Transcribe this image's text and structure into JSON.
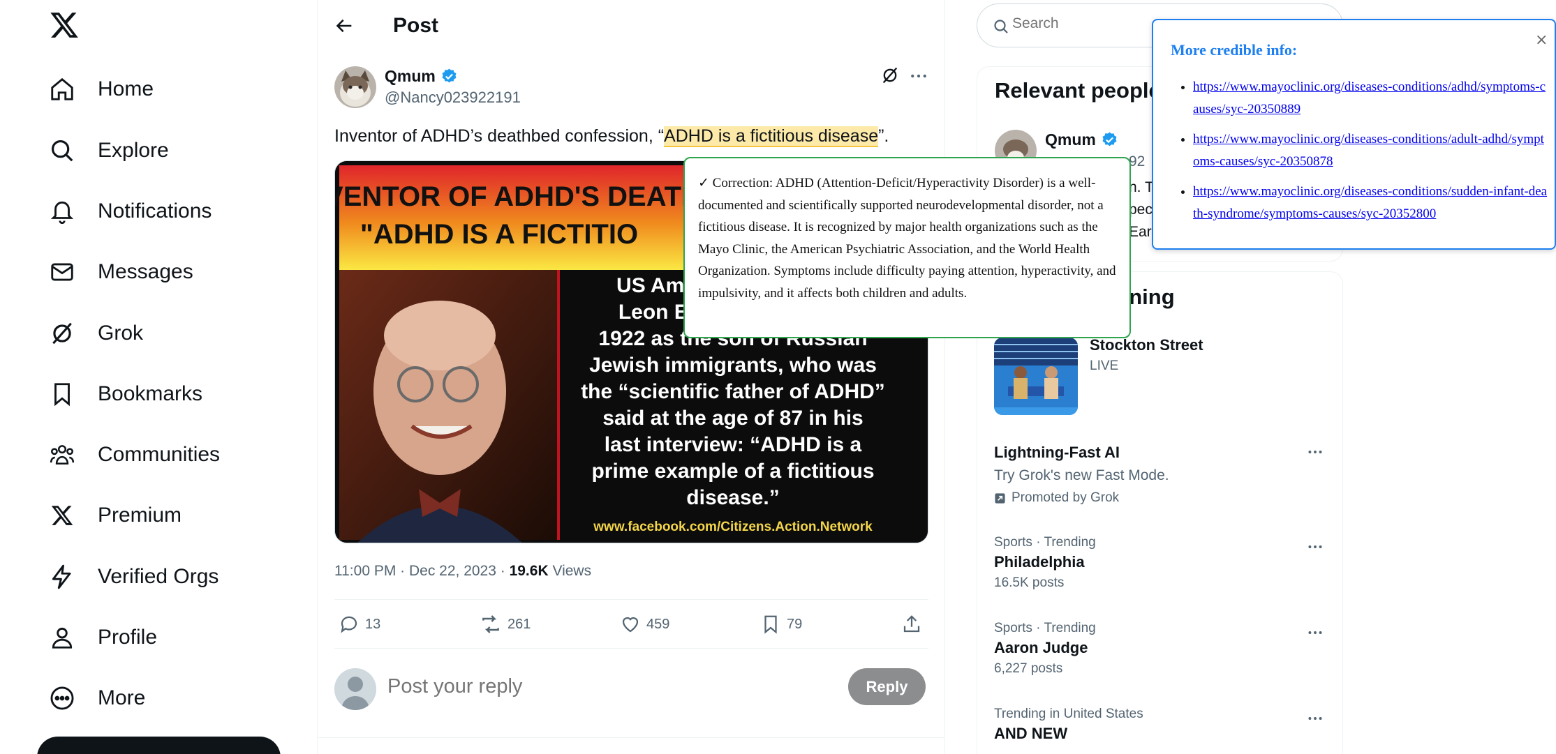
{
  "nav": {
    "items": [
      {
        "label": "Home",
        "icon": "home-icon"
      },
      {
        "label": "Explore",
        "icon": "search-icon"
      },
      {
        "label": "Notifications",
        "icon": "bell-icon"
      },
      {
        "label": "Messages",
        "icon": "envelope-icon"
      },
      {
        "label": "Grok",
        "icon": "grok-icon"
      },
      {
        "label": "Bookmarks",
        "icon": "bookmark-icon"
      },
      {
        "label": "Communities",
        "icon": "communities-icon"
      },
      {
        "label": "Premium",
        "icon": "x-logo-icon"
      },
      {
        "label": "Verified Orgs",
        "icon": "lightning-icon"
      },
      {
        "label": "Profile",
        "icon": "person-icon"
      },
      {
        "label": "More",
        "icon": "more-circle-icon"
      }
    ]
  },
  "header": {
    "title": "Post"
  },
  "post": {
    "author_name": "Qmum",
    "author_handle": "@Nancy023922191",
    "text_before": "Inventor of ADHD’s deathbed confession, “",
    "text_highlight": "ADHD is a fictitious disease",
    "text_after": "”.",
    "image": {
      "headline_1": "INVENTOR OF ADHD'S DEATH",
      "headline_2": "\"ADHD IS A FICTITIO",
      "body_lines": [
        "US Ame",
        "Leon Ei",
        "1922 as the son of Russian",
        "Jewish immigrants, who was",
        "the “scientific father of ADHD”",
        "said at the age of 87 in his",
        "last interview: “ADHD is a",
        "prime example of a fictitious",
        "disease.”"
      ],
      "source": "www.facebook.com/Citizens.Action.Network"
    },
    "time": "11:00 PM · Dec 22, 2023 · ",
    "views_count": "19.6K",
    "views_label": " Views",
    "stats": {
      "replies": "13",
      "reposts": "261",
      "likes": "459",
      "bookmarks": "79"
    }
  },
  "reply": {
    "placeholder": "Post your reply",
    "button_label": "Reply"
  },
  "sidebar": {
    "search_placeholder": "Search",
    "relevant_title": "Relevant people",
    "relevant_name": "Qmum",
    "relevant_handle_fragment": "92",
    "relevant_bio_fragments": [
      "n. T",
      "pec",
      "Ear"
    ],
    "happening_title": "ening",
    "happening": [
      {
        "name": "Stockton Street",
        "sub": "LIVE"
      }
    ],
    "promo": {
      "name": "Lightning-Fast AI",
      "desc": "Try Grok's new Fast Mode.",
      "by": "Promoted by Grok"
    },
    "trends": [
      {
        "context": "Sports · Trending",
        "name": "Philadelphia",
        "count": "16.5K posts"
      },
      {
        "context": "Sports · Trending",
        "name": "Aaron Judge",
        "count": "6,227 posts"
      },
      {
        "context": "Trending in United States",
        "name": "AND NEW",
        "count": ""
      }
    ]
  },
  "credible": {
    "title": "More credible info:",
    "close": "×",
    "links": [
      "https://www.mayoclinic.org/diseases-conditions/adhd/symptoms-causes/syc-20350889",
      "https://www.mayoclinic.org/diseases-conditions/adult-adhd/symptoms-causes/syc-20350878",
      "https://www.mayoclinic.org/diseases-conditions/sudden-infant-death-syndrome/symptoms-causes/syc-20352800"
    ]
  },
  "correction": {
    "text": "✓ Correction: ADHD (Attention-Deficit/Hyperactivity Disorder) is a well-documented and scientifically supported neurodevelopmental disorder, not a fictitious disease. It is recognized by major health organizations such as the Mayo Clinic, the American Psychiatric Association, and the World Health Organization. Symptoms include difficulty paying attention, hyperactivity, and impulsivity, and it affects both children and adults."
  },
  "colors": {
    "brand": "#1d9bf0",
    "highlight": "#fde9a8",
    "correction_border": "#2ea44f",
    "credible_border": "#1d7ff0"
  }
}
